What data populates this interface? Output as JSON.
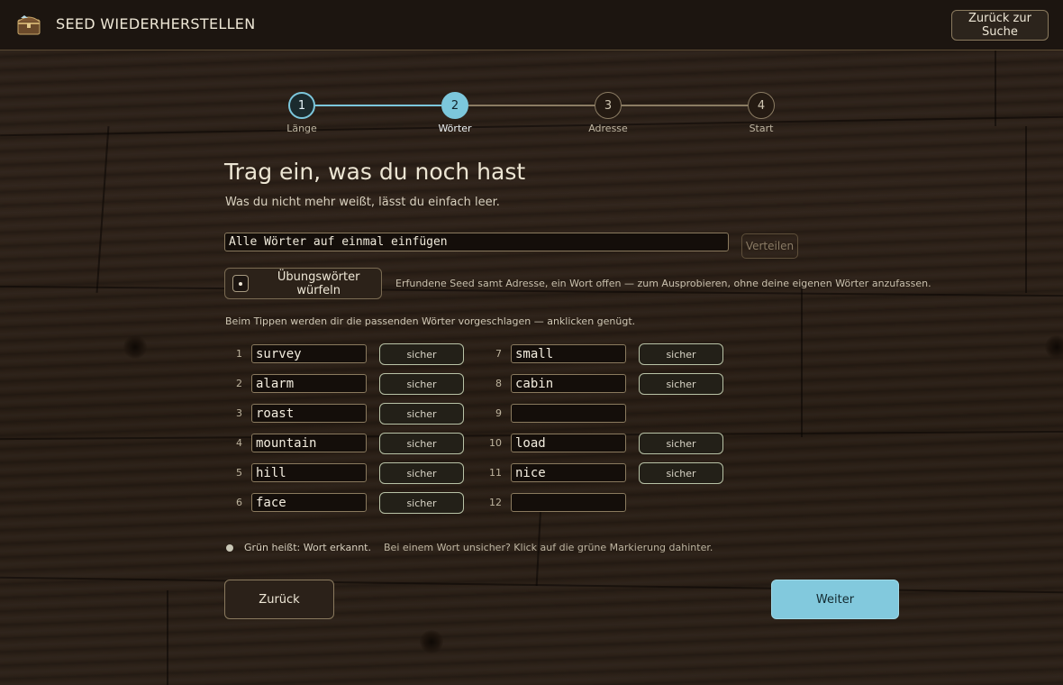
{
  "header": {
    "title": "SEED WIEDERHERSTELLEN",
    "logo_icon": "treasure-chest-icon",
    "back_to_search": "Zurück zur Suche"
  },
  "stepper": {
    "steps": [
      {
        "number": "1",
        "label": "Länge",
        "state": "done"
      },
      {
        "number": "2",
        "label": "Wörter",
        "state": "active"
      },
      {
        "number": "3",
        "label": "Adresse",
        "state": "pending"
      },
      {
        "number": "4",
        "label": "Start",
        "state": "pending"
      }
    ],
    "accent_color": "#7cc7dc"
  },
  "main": {
    "title": "Trag ein, was du noch hast",
    "subtitle": "Was du nicht mehr weißt, lässt du einfach leer.",
    "paste_value": "Alle Wörter auf einmal einfügen",
    "distribute_label": "Verteilen",
    "dice_label": "Übungswörter würfeln",
    "dice_note": "Erfundene Seed samt Adresse, ein Wort offen — zum Ausprobieren, ohne deine eigenen Wörter anzufassen.",
    "hint": "Beim Tippen werden dir die passenden Wörter vorgeschlagen — anklicken genügt."
  },
  "words": [
    {
      "num": "1",
      "value": "survey",
      "sure": "sicher"
    },
    {
      "num": "2",
      "value": "alarm",
      "sure": "sicher"
    },
    {
      "num": "3",
      "value": "roast",
      "sure": "sicher"
    },
    {
      "num": "4",
      "value": "mountain",
      "sure": "sicher"
    },
    {
      "num": "5",
      "value": "hill",
      "sure": "sicher"
    },
    {
      "num": "6",
      "value": "face",
      "sure": "sicher"
    },
    {
      "num": "7",
      "value": "small",
      "sure": "sicher"
    },
    {
      "num": "8",
      "value": "cabin",
      "sure": "sicher"
    },
    {
      "num": "9",
      "value": "",
      "sure": null
    },
    {
      "num": "10",
      "value": "load",
      "sure": "sicher"
    },
    {
      "num": "11",
      "value": "nice",
      "sure": "sicher"
    },
    {
      "num": "12",
      "value": "",
      "sure": null
    }
  ],
  "legend": {
    "recognized": "Grün heißt: Wort erkannt.",
    "hint": "Bei einem Wort unsicher? Klick auf die grüne Markierung dahinter."
  },
  "nav": {
    "back_label": "Zurück",
    "next_label": "Weiter"
  }
}
